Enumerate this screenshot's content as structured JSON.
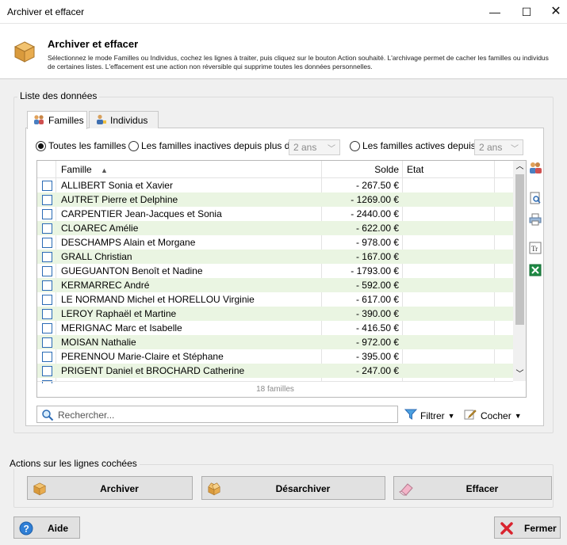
{
  "window": {
    "title": "Archiver et effacer",
    "minimize": "—",
    "maximize": "☐",
    "close": "✕"
  },
  "header": {
    "title": "Archiver et effacer",
    "description": "Sélectionnez le mode Familles ou Individus, cochez les lignes à traiter, puis cliquez sur le bouton Action souhaité. L'archivage permet de cacher les familles ou individus de certaines listes. L'effacement est une action non réversible qui supprime toutes les données personnelles."
  },
  "data_group": {
    "label": "Liste des données"
  },
  "tabs": [
    {
      "label": "Familles",
      "active": true
    },
    {
      "label": "Individus",
      "active": false
    }
  ],
  "filters": {
    "all_label": "Toutes les familles",
    "inactive_label": "Les familles inactives depuis plus de",
    "inactive_value": "2 ans",
    "active_label": "Les familles actives depuis",
    "active_value": "2 ans",
    "selected": "all"
  },
  "list": {
    "columns": {
      "famille": "Famille",
      "sort_indicator": "▲",
      "solde": "Solde",
      "etat": "Etat"
    },
    "rows": [
      {
        "famille": "ALLIBERT Sonia et Xavier",
        "solde": "- 267.50 €"
      },
      {
        "famille": "AUTRET Pierre et Delphine",
        "solde": "- 1269.00 €"
      },
      {
        "famille": "CARPENTIER Jean-Jacques et Sonia",
        "solde": "- 2440.00 €"
      },
      {
        "famille": "CLOAREC Amélie",
        "solde": "- 622.00 €"
      },
      {
        "famille": "DESCHAMPS Alain et Morgane",
        "solde": "- 978.00 €"
      },
      {
        "famille": "GRALL Christian",
        "solde": "- 167.00 €"
      },
      {
        "famille": "GUEGUANTON Benoît et Nadine",
        "solde": "- 1793.00 €"
      },
      {
        "famille": "KERMARREC André",
        "solde": "- 592.00 €"
      },
      {
        "famille": "LE NORMAND Michel et HORELLOU Virginie",
        "solde": "- 617.00 €"
      },
      {
        "famille": "LEROY Raphaël et Martine",
        "solde": "- 390.00 €"
      },
      {
        "famille": "MERIGNAC Marc et Isabelle",
        "solde": "- 416.50 €"
      },
      {
        "famille": "MOISAN Nathalie",
        "solde": "- 972.00 €"
      },
      {
        "famille": "PERENNOU Marie-Claire et Stéphane",
        "solde": "- 395.00 €"
      },
      {
        "famille": "PRIGENT Daniel et BROCHARD Catherine",
        "solde": "- 247.00 €"
      }
    ],
    "footer": "18 familles"
  },
  "search": {
    "placeholder": "Rechercher..."
  },
  "tools": {
    "filter_label": "Filtrer",
    "check_label": "Cocher",
    "caret": "▼"
  },
  "actions_group": {
    "label": "Actions sur les lignes cochées"
  },
  "actions": {
    "archive": "Archiver",
    "unarchive": "Désarchiver",
    "erase": "Effacer"
  },
  "bottom": {
    "help": "Aide",
    "close": "Fermer"
  },
  "colors": {
    "alt_row": "#eaf5e2",
    "checkbox_border": "#2b6bb5",
    "close_red": "#d9232e",
    "help_blue": "#2f7fd6"
  }
}
